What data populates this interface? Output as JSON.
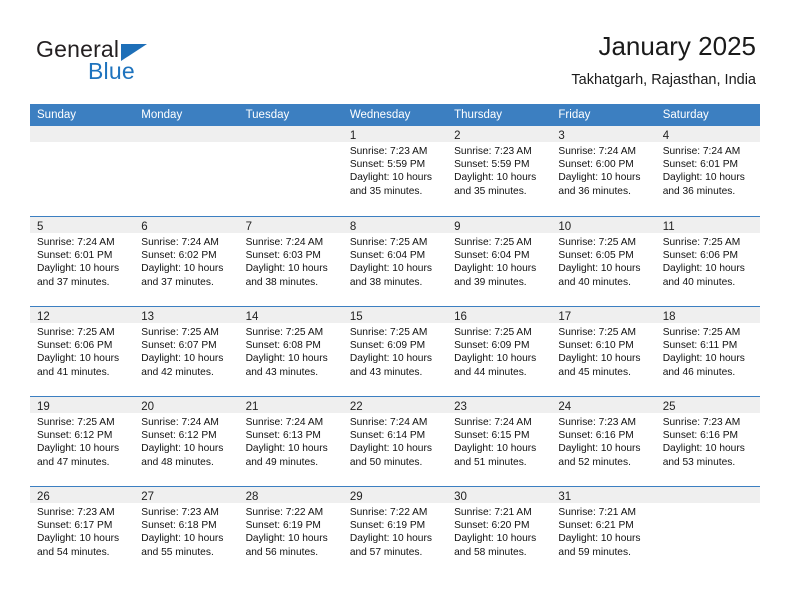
{
  "logo": {
    "word_top": "General",
    "word_bottom": "Blue",
    "accent_color": "#1e6fb8"
  },
  "header": {
    "title": "January 2025",
    "subtitle": "Takhatgarh, Rajasthan, India"
  },
  "calendar": {
    "header_bg": "#3c7fc1",
    "weekdays": [
      "Sunday",
      "Monday",
      "Tuesday",
      "Wednesday",
      "Thursday",
      "Friday",
      "Saturday"
    ],
    "weeks": [
      [
        {
          "day": "",
          "sunrise": "",
          "sunset": "",
          "daylight": ""
        },
        {
          "day": "",
          "sunrise": "",
          "sunset": "",
          "daylight": ""
        },
        {
          "day": "",
          "sunrise": "",
          "sunset": "",
          "daylight": ""
        },
        {
          "day": "1",
          "sunrise": "Sunrise: 7:23 AM",
          "sunset": "Sunset: 5:59 PM",
          "daylight": "Daylight: 10 hours and 35 minutes."
        },
        {
          "day": "2",
          "sunrise": "Sunrise: 7:23 AM",
          "sunset": "Sunset: 5:59 PM",
          "daylight": "Daylight: 10 hours and 35 minutes."
        },
        {
          "day": "3",
          "sunrise": "Sunrise: 7:24 AM",
          "sunset": "Sunset: 6:00 PM",
          "daylight": "Daylight: 10 hours and 36 minutes."
        },
        {
          "day": "4",
          "sunrise": "Sunrise: 7:24 AM",
          "sunset": "Sunset: 6:01 PM",
          "daylight": "Daylight: 10 hours and 36 minutes."
        }
      ],
      [
        {
          "day": "5",
          "sunrise": "Sunrise: 7:24 AM",
          "sunset": "Sunset: 6:01 PM",
          "daylight": "Daylight: 10 hours and 37 minutes."
        },
        {
          "day": "6",
          "sunrise": "Sunrise: 7:24 AM",
          "sunset": "Sunset: 6:02 PM",
          "daylight": "Daylight: 10 hours and 37 minutes."
        },
        {
          "day": "7",
          "sunrise": "Sunrise: 7:24 AM",
          "sunset": "Sunset: 6:03 PM",
          "daylight": "Daylight: 10 hours and 38 minutes."
        },
        {
          "day": "8",
          "sunrise": "Sunrise: 7:25 AM",
          "sunset": "Sunset: 6:04 PM",
          "daylight": "Daylight: 10 hours and 38 minutes."
        },
        {
          "day": "9",
          "sunrise": "Sunrise: 7:25 AM",
          "sunset": "Sunset: 6:04 PM",
          "daylight": "Daylight: 10 hours and 39 minutes."
        },
        {
          "day": "10",
          "sunrise": "Sunrise: 7:25 AM",
          "sunset": "Sunset: 6:05 PM",
          "daylight": "Daylight: 10 hours and 40 minutes."
        },
        {
          "day": "11",
          "sunrise": "Sunrise: 7:25 AM",
          "sunset": "Sunset: 6:06 PM",
          "daylight": "Daylight: 10 hours and 40 minutes."
        }
      ],
      [
        {
          "day": "12",
          "sunrise": "Sunrise: 7:25 AM",
          "sunset": "Sunset: 6:06 PM",
          "daylight": "Daylight: 10 hours and 41 minutes."
        },
        {
          "day": "13",
          "sunrise": "Sunrise: 7:25 AM",
          "sunset": "Sunset: 6:07 PM",
          "daylight": "Daylight: 10 hours and 42 minutes."
        },
        {
          "day": "14",
          "sunrise": "Sunrise: 7:25 AM",
          "sunset": "Sunset: 6:08 PM",
          "daylight": "Daylight: 10 hours and 43 minutes."
        },
        {
          "day": "15",
          "sunrise": "Sunrise: 7:25 AM",
          "sunset": "Sunset: 6:09 PM",
          "daylight": "Daylight: 10 hours and 43 minutes."
        },
        {
          "day": "16",
          "sunrise": "Sunrise: 7:25 AM",
          "sunset": "Sunset: 6:09 PM",
          "daylight": "Daylight: 10 hours and 44 minutes."
        },
        {
          "day": "17",
          "sunrise": "Sunrise: 7:25 AM",
          "sunset": "Sunset: 6:10 PM",
          "daylight": "Daylight: 10 hours and 45 minutes."
        },
        {
          "day": "18",
          "sunrise": "Sunrise: 7:25 AM",
          "sunset": "Sunset: 6:11 PM",
          "daylight": "Daylight: 10 hours and 46 minutes."
        }
      ],
      [
        {
          "day": "19",
          "sunrise": "Sunrise: 7:25 AM",
          "sunset": "Sunset: 6:12 PM",
          "daylight": "Daylight: 10 hours and 47 minutes."
        },
        {
          "day": "20",
          "sunrise": "Sunrise: 7:24 AM",
          "sunset": "Sunset: 6:12 PM",
          "daylight": "Daylight: 10 hours and 48 minutes."
        },
        {
          "day": "21",
          "sunrise": "Sunrise: 7:24 AM",
          "sunset": "Sunset: 6:13 PM",
          "daylight": "Daylight: 10 hours and 49 minutes."
        },
        {
          "day": "22",
          "sunrise": "Sunrise: 7:24 AM",
          "sunset": "Sunset: 6:14 PM",
          "daylight": "Daylight: 10 hours and 50 minutes."
        },
        {
          "day": "23",
          "sunrise": "Sunrise: 7:24 AM",
          "sunset": "Sunset: 6:15 PM",
          "daylight": "Daylight: 10 hours and 51 minutes."
        },
        {
          "day": "24",
          "sunrise": "Sunrise: 7:23 AM",
          "sunset": "Sunset: 6:16 PM",
          "daylight": "Daylight: 10 hours and 52 minutes."
        },
        {
          "day": "25",
          "sunrise": "Sunrise: 7:23 AM",
          "sunset": "Sunset: 6:16 PM",
          "daylight": "Daylight: 10 hours and 53 minutes."
        }
      ],
      [
        {
          "day": "26",
          "sunrise": "Sunrise: 7:23 AM",
          "sunset": "Sunset: 6:17 PM",
          "daylight": "Daylight: 10 hours and 54 minutes."
        },
        {
          "day": "27",
          "sunrise": "Sunrise: 7:23 AM",
          "sunset": "Sunset: 6:18 PM",
          "daylight": "Daylight: 10 hours and 55 minutes."
        },
        {
          "day": "28",
          "sunrise": "Sunrise: 7:22 AM",
          "sunset": "Sunset: 6:19 PM",
          "daylight": "Daylight: 10 hours and 56 minutes."
        },
        {
          "day": "29",
          "sunrise": "Sunrise: 7:22 AM",
          "sunset": "Sunset: 6:19 PM",
          "daylight": "Daylight: 10 hours and 57 minutes."
        },
        {
          "day": "30",
          "sunrise": "Sunrise: 7:21 AM",
          "sunset": "Sunset: 6:20 PM",
          "daylight": "Daylight: 10 hours and 58 minutes."
        },
        {
          "day": "31",
          "sunrise": "Sunrise: 7:21 AM",
          "sunset": "Sunset: 6:21 PM",
          "daylight": "Daylight: 10 hours and 59 minutes."
        },
        {
          "day": "",
          "sunrise": "",
          "sunset": "",
          "daylight": ""
        }
      ]
    ]
  }
}
